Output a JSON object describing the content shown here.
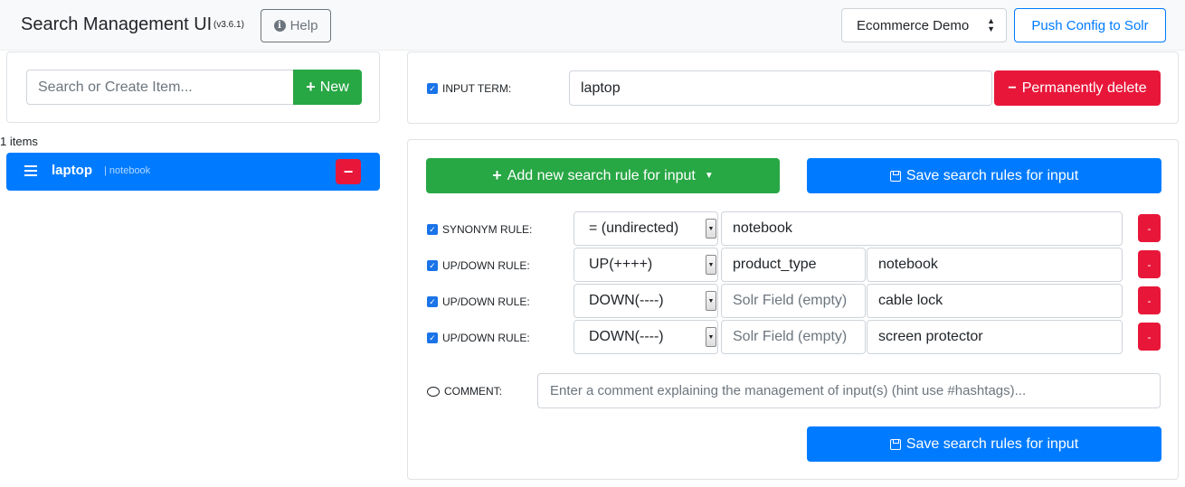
{
  "header": {
    "title": "Search Management UI",
    "version": "(v3.6.1)",
    "help_label": "Help",
    "solr_index": "Ecommerce Demo",
    "push_label": "Push Config to Solr"
  },
  "sidebar": {
    "search_placeholder": "Search or Create Item...",
    "new_label": "New",
    "items_count": "1 items",
    "items": [
      {
        "term": "laptop",
        "synonyms": "| notebook",
        "delete_label": "−"
      }
    ]
  },
  "input_term": {
    "label": "INPUT TERM:",
    "value": "laptop",
    "delete_label": "Permanently delete"
  },
  "rules": {
    "add_label": "Add new search rule for input",
    "save_label": "Save search rules for input",
    "list": [
      {
        "label": "SYNONYM RULE:",
        "type": "= (undirected)",
        "term": "notebook",
        "delete_label": "-"
      },
      {
        "label": "UP/DOWN RULE:",
        "type": "UP(++++)",
        "field": "product_type",
        "term": "notebook",
        "delete_label": "-"
      },
      {
        "label": "UP/DOWN RULE:",
        "type": "DOWN(----)",
        "field_placeholder": "Solr Field (empty)",
        "term": "cable lock",
        "delete_label": "-"
      },
      {
        "label": "UP/DOWN RULE:",
        "type": "DOWN(----)",
        "field_placeholder": "Solr Field (empty)",
        "term": "screen protector",
        "delete_label": "-"
      }
    ],
    "comment_label": "COMMENT:",
    "comment_placeholder": "Enter a comment explaining the management of input(s) (hint use #hashtags)..."
  },
  "colors": {
    "primary": "#007bff",
    "success": "#28a745",
    "danger": "#e8173a"
  }
}
